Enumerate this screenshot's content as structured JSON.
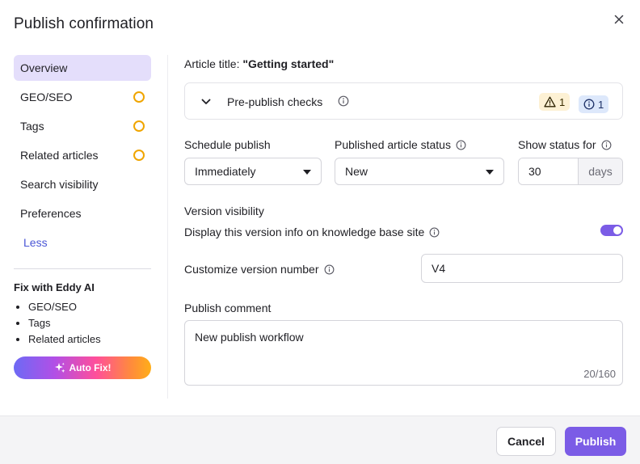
{
  "dialog": {
    "title": "Publish confirmation"
  },
  "sidebar": {
    "items": [
      {
        "label": "Overview",
        "active": true,
        "pending": false
      },
      {
        "label": "GEO/SEO",
        "active": false,
        "pending": true
      },
      {
        "label": "Tags",
        "active": false,
        "pending": true
      },
      {
        "label": "Related articles",
        "active": false,
        "pending": true
      },
      {
        "label": "Search visibility",
        "active": false,
        "pending": false
      },
      {
        "label": "Preferences",
        "active": false,
        "pending": false
      }
    ],
    "less_label": "Less",
    "fix": {
      "title": "Fix with Eddy AI",
      "items": [
        "GEO/SEO",
        "Tags",
        "Related articles"
      ],
      "button_label": "Auto Fix!"
    }
  },
  "main": {
    "article_title_label": "Article title:",
    "article_title_value": "\"Getting started\"",
    "checks": {
      "label": "Pre-publish checks",
      "warnings": "1",
      "infos": "1"
    },
    "schedule": {
      "label": "Schedule publish",
      "value": "Immediately"
    },
    "status": {
      "label": "Published article status",
      "value": "New"
    },
    "show_status": {
      "label": "Show status for",
      "value": "30",
      "unit": "days"
    },
    "version": {
      "title": "Version visibility",
      "display_label": "Display this version info on knowledge base site",
      "toggle_on": true,
      "number_label": "Customize version number",
      "number_value": "V4"
    },
    "comment": {
      "label": "Publish comment",
      "value": "New publish workflow",
      "counter": "20/160"
    }
  },
  "footer": {
    "cancel_label": "Cancel",
    "publish_label": "Publish"
  },
  "colors": {
    "accent": "#7b5ce6",
    "active_nav": "#e4defb",
    "pending": "#f0a500",
    "link": "#4a56d6"
  }
}
